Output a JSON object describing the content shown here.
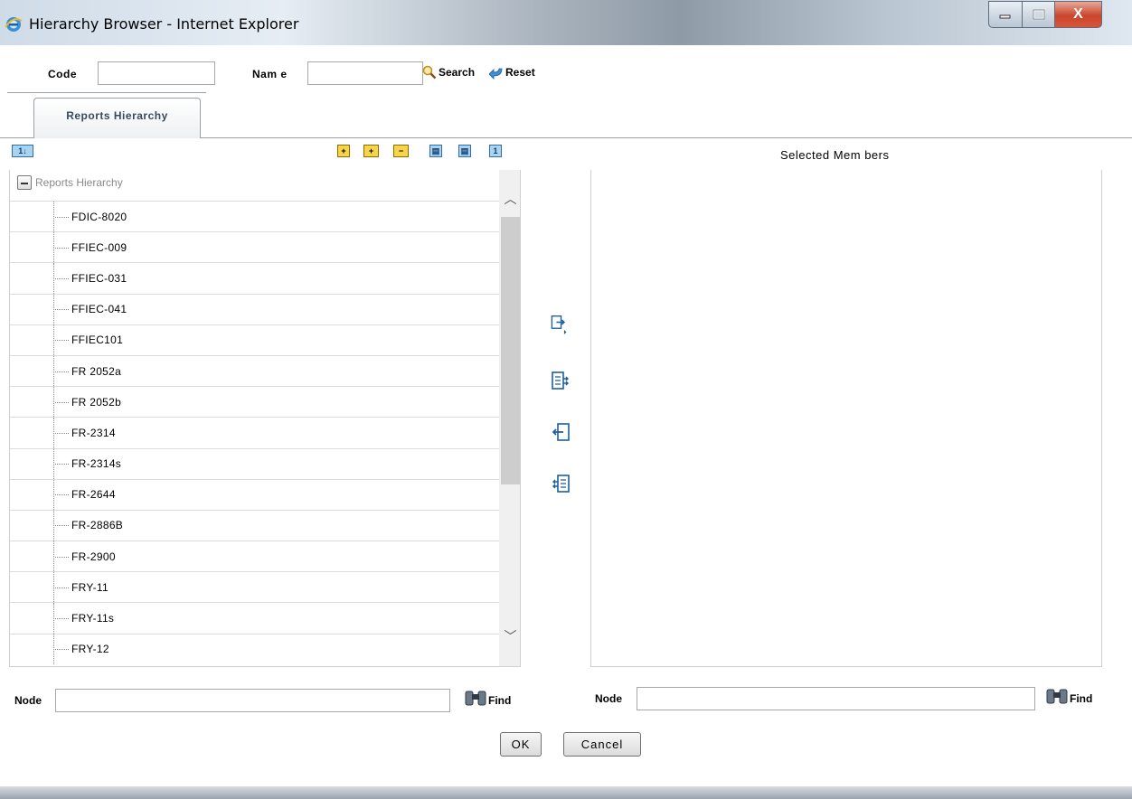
{
  "window": {
    "title": "Hierarchy Browser - Internet Explorer",
    "controls": {
      "close_glyph": "X"
    }
  },
  "search": {
    "code_label": "Code",
    "code_value": "",
    "name_label": "Nam e",
    "name_value": "",
    "search_label": "Search",
    "reset_label": "Reset"
  },
  "tabs": [
    {
      "label": "Reports Hierarchy"
    }
  ],
  "toolbar": {
    "icons": [
      "sort-icon",
      "expand-all-icon",
      "expand-selected-icon",
      "collapse-icon",
      "grid-icon",
      "grid-alt-icon",
      "number-icon"
    ],
    "sort_glyph": "1↓",
    "number_glyph": "1"
  },
  "tree": {
    "root_label": "Reports Hierarchy",
    "items": [
      "FDIC-8020",
      "FFIEC-009",
      "FFIEC-031",
      "FFIEC-041",
      "FFIEC101",
      "FR 2052a",
      "FR 2052b",
      "FR-2314",
      "FR-2314s",
      "FR-2644",
      "FR-2886B",
      "FR-2900",
      "FRY-11",
      "FRY-11s",
      "FRY-12"
    ]
  },
  "selected": {
    "title": "Selected Mem bers"
  },
  "left_find": {
    "node_label": "Node",
    "node_value": "",
    "find_label": "Find"
  },
  "right_find": {
    "node_label": "Node",
    "node_value": "",
    "find_label": "Find"
  },
  "actions": {
    "ok_label": "OK",
    "cancel_label": "Cancel"
  }
}
